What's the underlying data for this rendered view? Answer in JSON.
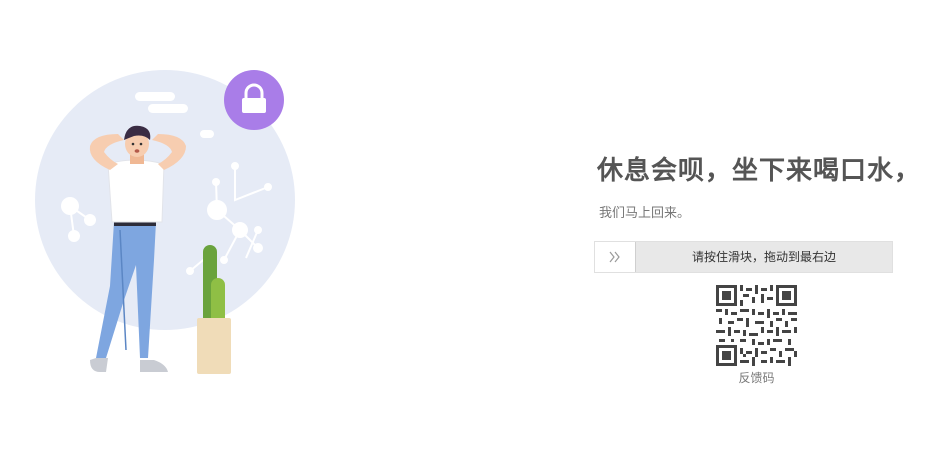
{
  "message": {
    "headline": "休息会呗，坐下来喝口水，",
    "subtext": "我们马上回来。"
  },
  "slider": {
    "label": "请按住滑块，拖动到最右边",
    "handle_icon": "double-chevron-right-icon"
  },
  "feedback": {
    "qr_label": "反馈码",
    "qr_icon": "qr-code-icon"
  },
  "colors": {
    "lock_badge": "#a97de8",
    "background_circle": "#e6ebf6",
    "shirt": "#ffffff",
    "jeans": "#7ea6e0",
    "cactus": "#6aa33d",
    "pot": "#f0dcb8",
    "slider_track": "#e8e8e8"
  }
}
